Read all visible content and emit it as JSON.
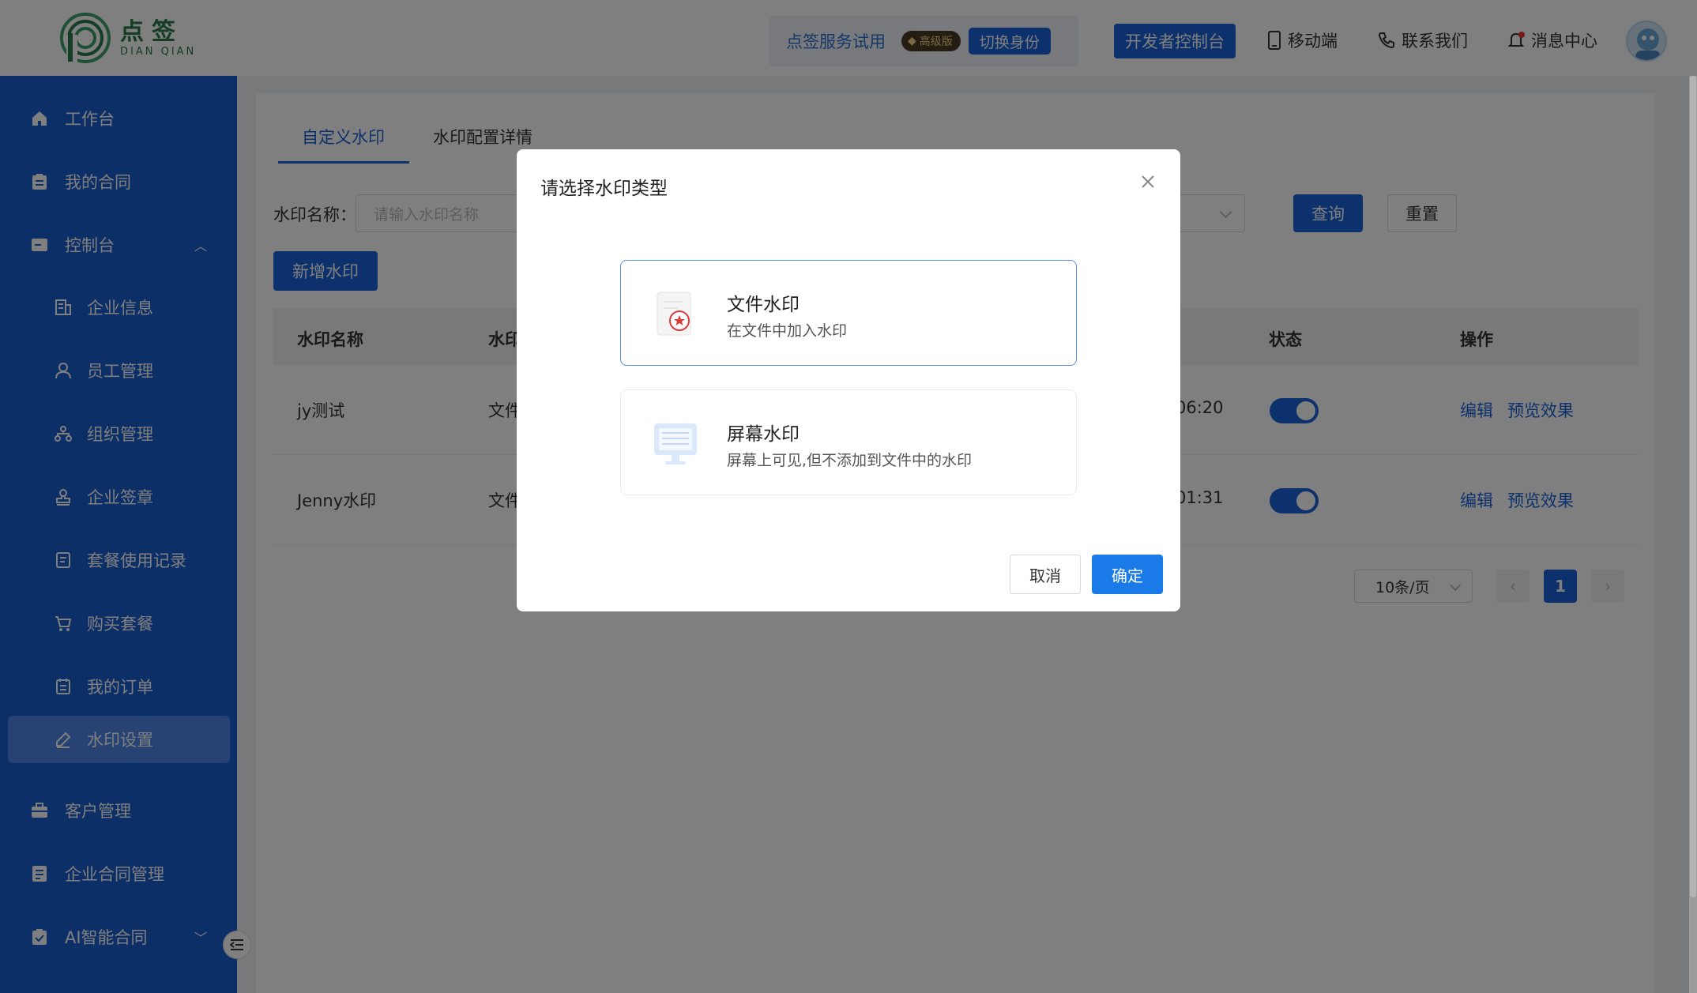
{
  "brand": {
    "name_cn": "点签",
    "name_en": "DIAN QIAN"
  },
  "header": {
    "trial_text": "点签服务试用",
    "vip_badge": "高级版",
    "switch_identity": "切换身份",
    "dev_console": "开发者控制台",
    "mobile": "移动端",
    "contact": "联系我们",
    "messages": "消息中心"
  },
  "sidebar": {
    "items": [
      {
        "label": "工作台",
        "icon": "home-icon"
      },
      {
        "label": "我的合同",
        "icon": "clipboard-icon"
      },
      {
        "label": "控制台",
        "icon": "console-icon"
      },
      {
        "label": "企业信息",
        "icon": "building-icon"
      },
      {
        "label": "员工管理",
        "icon": "user-icon"
      },
      {
        "label": "组织管理",
        "icon": "org-chart-icon"
      },
      {
        "label": "企业签章",
        "icon": "stamp-icon"
      },
      {
        "label": "套餐使用记录",
        "icon": "record-icon"
      },
      {
        "label": "购买套餐",
        "icon": "cart-icon"
      },
      {
        "label": "我的订单",
        "icon": "order-icon"
      },
      {
        "label": "水印设置",
        "icon": "pen-icon"
      },
      {
        "label": "客户管理",
        "icon": "briefcase-icon"
      },
      {
        "label": "企业合同管理",
        "icon": "contract-icon"
      },
      {
        "label": "AI智能合同",
        "icon": "ai-contract-icon"
      }
    ]
  },
  "tabs": {
    "custom": "自定义水印",
    "detail": "水印配置详情"
  },
  "filter": {
    "label": "水印名称：",
    "placeholder": "请输入水印名称",
    "query": "查询",
    "reset": "重置",
    "add": "新增水印"
  },
  "table": {
    "headers": {
      "name": "水印名称",
      "type": "水印",
      "status": "状态",
      "ops": "操作"
    },
    "rows": [
      {
        "name": "jy测试",
        "type": "文件",
        "time": "06:20",
        "edit": "编辑",
        "preview": "预览效果",
        "enabled": true
      },
      {
        "name": "Jenny水印",
        "type": "文件",
        "time": "01:31",
        "edit": "编辑",
        "preview": "预览效果",
        "enabled": true
      }
    ]
  },
  "pagination": {
    "page_size": "10条/页",
    "current": "1"
  },
  "modal": {
    "title": "请选择水印类型",
    "options": [
      {
        "name": "文件水印",
        "desc": "在文件中加入水印",
        "selected": true
      },
      {
        "name": "屏幕水印",
        "desc": "屏幕上可见,但不添加到文件中的水印",
        "selected": false
      }
    ],
    "cancel": "取消",
    "confirm": "确定"
  },
  "colors": {
    "primary": "#1a62d8",
    "sidebar": "#1a5fd0",
    "brand_green": "#2a7a4a"
  }
}
